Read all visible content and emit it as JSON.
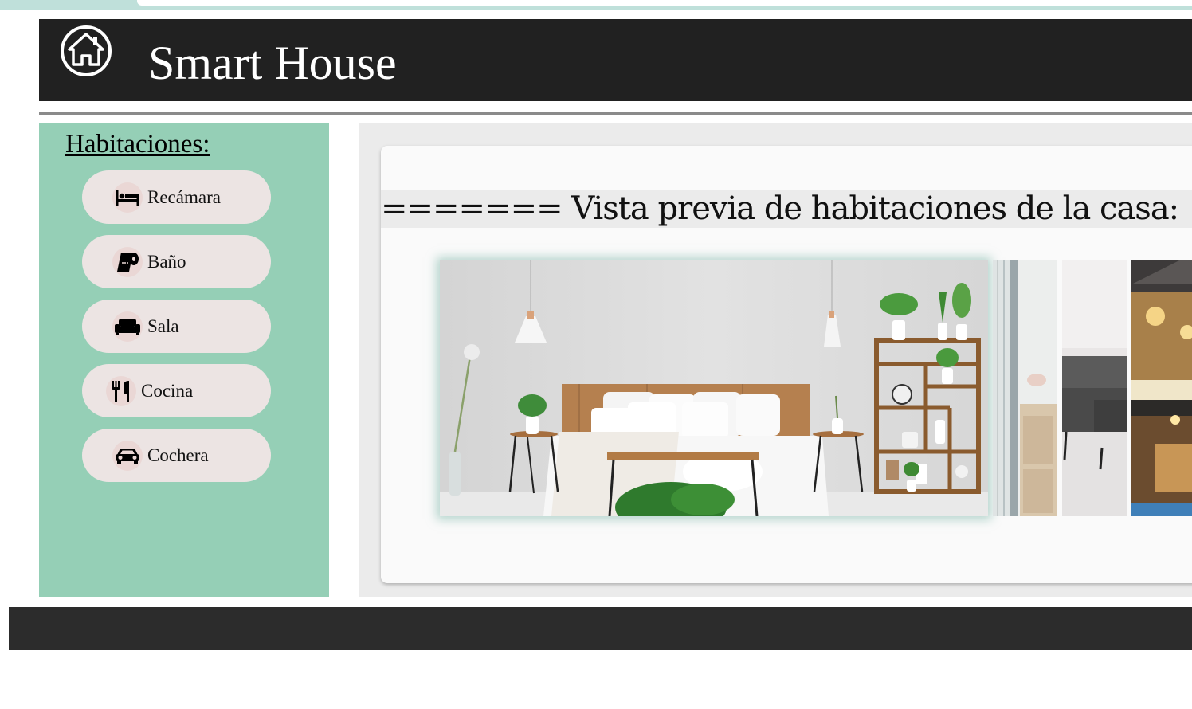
{
  "header": {
    "title": "Smart House",
    "logo_icon": "home-icon"
  },
  "sidebar": {
    "title": "Habitaciones:",
    "items": [
      {
        "label": "Recámara",
        "icon": "bed-icon"
      },
      {
        "label": "Baño",
        "icon": "toilet-paper-icon"
      },
      {
        "label": "Sala",
        "icon": "couch-icon"
      },
      {
        "label": "Cocina",
        "icon": "utensils-icon"
      },
      {
        "label": "Cochera",
        "icon": "car-icon"
      }
    ]
  },
  "main": {
    "heading": "======= Vista previa de habitaciones de la casa:",
    "slides": [
      {
        "name": "bedroom"
      },
      {
        "name": "bathroom"
      },
      {
        "name": "living-room"
      },
      {
        "name": "garage"
      }
    ]
  },
  "colors": {
    "header_bg": "#212121",
    "sidebar_bg": "#95cfb6",
    "button_bg": "#ece4e3",
    "footer_bg": "#2c2c2c",
    "main_bg": "#ebebeb"
  }
}
